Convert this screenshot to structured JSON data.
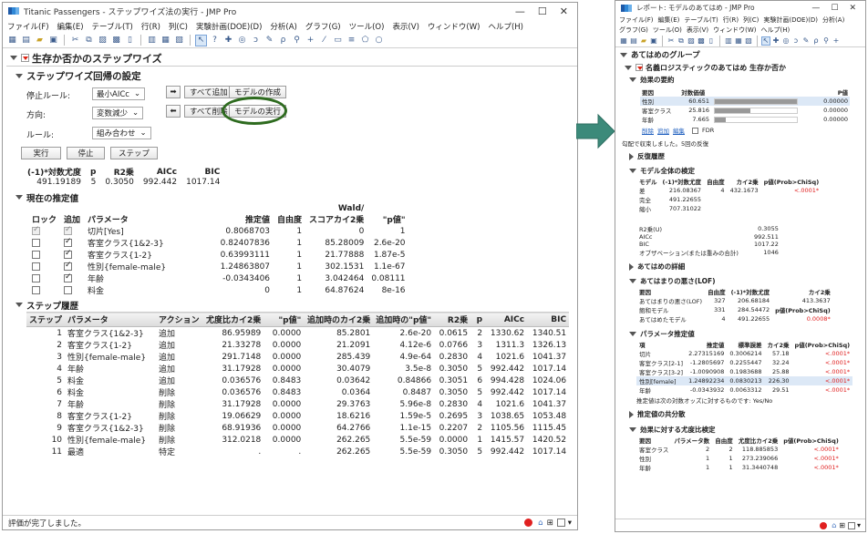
{
  "main": {
    "title": "Titanic Passengers - ステップワイズ法の実行 - JMP Pro",
    "menu": [
      "ファイル(F)",
      "編集(E)",
      "テーブル(T)",
      "行(R)",
      "列(C)",
      "実験計画(DOE)(D)",
      "分析(A)",
      "グラフ(G)",
      "ツール(O)",
      "表示(V)",
      "ウィンドウ(W)",
      "ヘルプ(H)"
    ],
    "report_title": "生存か否かのステップワイズ",
    "settings_title": "ステップワイズ回帰の設定",
    "stop_rule_label": "停止ルール:",
    "stop_rule_value": "最小AICc",
    "direction_label": "方向:",
    "direction_value": "変数減少",
    "rule_label": "ルール:",
    "rule_value": "組み合わせ",
    "btn_add_all": "すべて追加",
    "btn_make_model": "モデルの作成",
    "btn_remove_all": "すべて削除",
    "btn_run_model": "モデルの実行",
    "btn_go": "実行",
    "btn_stop": "停止",
    "btn_step": "ステップ",
    "summary_headers": [
      "(-1)*対数尤度",
      "p",
      "R2乗",
      "AICc",
      "BIC"
    ],
    "summary_values": [
      "491.19189",
      "5",
      "0.3050",
      "992.442",
      "1017.14"
    ],
    "current_est_title": "現在の推定値",
    "est_headers": [
      "ロック",
      "追加",
      "パラメータ",
      "推定値",
      "自由度",
      "スコアカイ2乗",
      "\"p値\""
    ],
    "est_wald": "Wald/",
    "est_rows": [
      {
        "lock": true,
        "lockdis": true,
        "add": true,
        "adddis": true,
        "param": "切片[Yes]",
        "est": "0.8068703",
        "df": "1",
        "chi": "0",
        "p": "1"
      },
      {
        "lock": false,
        "add": true,
        "param": "客室クラス{1&2-3}",
        "est": "0.82407836",
        "df": "1",
        "chi": "85.28009",
        "p": "2.6e-20"
      },
      {
        "lock": false,
        "add": true,
        "param": "客室クラス{1-2}",
        "est": "0.63993111",
        "df": "1",
        "chi": "21.77888",
        "p": "1.87e-5"
      },
      {
        "lock": false,
        "add": true,
        "param": "性別{female-male}",
        "est": "1.24863807",
        "df": "1",
        "chi": "302.1531",
        "p": "1.1e-67"
      },
      {
        "lock": false,
        "add": true,
        "param": "年齢",
        "est": "-0.0343406",
        "df": "1",
        "chi": "3.042464",
        "p": "0.08111"
      },
      {
        "lock": false,
        "add": false,
        "param": "料金",
        "est": "0",
        "df": "1",
        "chi": "64.87624",
        "p": "8e-16"
      }
    ],
    "history_title": "ステップ履歴",
    "hist_headers": [
      "ステップ",
      "パラメータ",
      "アクション",
      "尤度比カイ2乗",
      "\"p値\"",
      "追加時のカイ2乗",
      "追加時の\"p値\"",
      "R2乗",
      "p",
      "AICc",
      "BIC"
    ],
    "hist_rows": [
      [
        "1",
        "客室クラス{1&2-3}",
        "追加",
        "86.95989",
        "0.0000",
        "85.2801",
        "2.6e-20",
        "0.0615",
        "2",
        "1330.62",
        "1340.51"
      ],
      [
        "2",
        "客室クラス{1-2}",
        "追加",
        "21.33278",
        "0.0000",
        "21.2091",
        "4.12e-6",
        "0.0766",
        "3",
        "1311.3",
        "1326.13"
      ],
      [
        "3",
        "性別{female-male}",
        "追加",
        "291.7148",
        "0.0000",
        "285.439",
        "4.9e-64",
        "0.2830",
        "4",
        "1021.6",
        "1041.37"
      ],
      [
        "4",
        "年齢",
        "追加",
        "31.17928",
        "0.0000",
        "30.4079",
        "3.5e-8",
        "0.3050",
        "5",
        "992.442",
        "1017.14"
      ],
      [
        "5",
        "料金",
        "追加",
        "0.036576",
        "0.8483",
        "0.03642",
        "0.84866",
        "0.3051",
        "6",
        "994.428",
        "1024.06"
      ],
      [
        "6",
        "料金",
        "削除",
        "0.036576",
        "0.8483",
        "0.0364",
        "0.8487",
        "0.3050",
        "5",
        "992.442",
        "1017.14"
      ],
      [
        "7",
        "年齢",
        "削除",
        "31.17928",
        "0.0000",
        "29.3763",
        "5.96e-8",
        "0.2830",
        "4",
        "1021.6",
        "1041.37"
      ],
      [
        "8",
        "客室クラス{1-2}",
        "削除",
        "19.06629",
        "0.0000",
        "18.6216",
        "1.59e-5",
        "0.2695",
        "3",
        "1038.65",
        "1053.48"
      ],
      [
        "9",
        "客室クラス{1&2-3}",
        "削除",
        "68.91936",
        "0.0000",
        "64.2766",
        "1.1e-15",
        "0.2207",
        "2",
        "1105.56",
        "1115.45"
      ],
      [
        "10",
        "性別{female-male}",
        "削除",
        "312.0218",
        "0.0000",
        "262.265",
        "5.5e-59",
        "0.0000",
        "1",
        "1415.57",
        "1420.52"
      ],
      [
        "11",
        "最適",
        "特定",
        ".",
        ".",
        "262.265",
        "5.5e-59",
        "0.3050",
        "5",
        "992.442",
        "1017.14"
      ]
    ],
    "status": "評価が完了しました。"
  },
  "report": {
    "title": "レポート: モデルのあてはめ - JMP Pro",
    "menu1": [
      "ファイル(F)",
      "編集(E)",
      "テーブル(T)",
      "行(R)",
      "列(C)",
      "実験計画(DOE)(D)",
      "分析(A)"
    ],
    "menu2": [
      "グラフ(G)",
      "ツール(O)",
      "表示(V)",
      "ウィンドウ(W)",
      "ヘルプ(H)"
    ],
    "group_title": "あてはめのグループ",
    "logistic_title": "名義ロジスティックのあてはめ 生存か否か",
    "effect_summary_title": "効果の要約",
    "effect_headers": [
      "要因",
      "対数価値",
      "P値"
    ],
    "effect_rows": [
      {
        "name": "性別",
        "val": "60.651",
        "frac": 1.0,
        "p": "0.00000"
      },
      {
        "name": "客室クラス",
        "val": "25.816",
        "frac": 0.43,
        "p": "0.00000"
      },
      {
        "name": "年齢",
        "val": "7.665",
        "frac": 0.13,
        "p": "0.00000"
      }
    ],
    "effect_links": [
      "削除",
      "追加",
      "編集"
    ],
    "fdr_label": "FDR",
    "converge_note": "勾配で収束しました。5回の反復",
    "iter_title": "反復履歴",
    "whole_title": "モデル全体の検定",
    "whole_headers": [
      "モデル",
      "(-1)*対数尤度",
      "自由度",
      "カイ2乗",
      "p値(Prob>ChiSq)"
    ],
    "whole_rows": [
      [
        "差",
        "216.08367",
        "4",
        "432.1673",
        "<.0001*"
      ],
      [
        "完全",
        "491.22655",
        "",
        "",
        ""
      ],
      [
        "縮小",
        "707.31022",
        "",
        "",
        ""
      ]
    ],
    "stats_labels": [
      "R2乗(U)",
      "AICc",
      "BIC",
      "オブザベーション(または重みの合計)"
    ],
    "stats_values": [
      "0.3055",
      "992.511",
      "1017.22",
      "1046"
    ],
    "detail_title": "あてはめの詳細",
    "lof_title": "あてはまりの悪さ(LOF)",
    "lof_headers": [
      "要因",
      "自由度",
      "(-1)*対数尤度",
      "カイ2乗"
    ],
    "lof_rows": [
      [
        "あてはまりの悪さ(LOF)",
        "327",
        "206.68184",
        "413.3637"
      ],
      [
        "飽和モデル",
        "331",
        "284.54472",
        "p値(Prob>ChiSq)"
      ],
      [
        "あてはめたモデル",
        "4",
        "491.22655",
        "0.0008*"
      ]
    ],
    "param_title": "パラメータ推定値",
    "param_headers": [
      "項",
      "推定値",
      "標準誤差",
      "カイ2乗",
      "p値(Prob>ChiSq)"
    ],
    "param_rows": [
      [
        "切片",
        "2.27315169",
        "0.3006214",
        "57.18",
        "<.0001*"
      ],
      [
        "客室クラス[2-1]",
        "-1.2805697",
        "0.2255447",
        "32.24",
        "<.0001*"
      ],
      [
        "客室クラス[3-2]",
        "-1.0090908",
        "0.1983688",
        "25.88",
        "<.0001*"
      ],
      [
        "性別[female]",
        "1.24892234",
        "0.0830213",
        "226.30",
        "<.0001*"
      ],
      [
        "年齢",
        "-0.0343932",
        "0.0063312",
        "29.51",
        "<.0001*"
      ]
    ],
    "param_note": "推定値は次の対数オッズに対するものです: Yes/No",
    "cov_title": "推定値の共分散",
    "lr_title": "効果に対する尤度比検定",
    "lr_headers": [
      "要因",
      "パラメータ数",
      "自由度",
      "尤度比カイ2乗",
      "p値(Prob>ChiSq)"
    ],
    "lr_rows": [
      [
        "客室クラス",
        "2",
        "2",
        "118.885853",
        "<.0001*"
      ],
      [
        "性別",
        "1",
        "1",
        "273.239066",
        "<.0001*"
      ],
      [
        "年齢",
        "1",
        "1",
        "31.3440748",
        "<.0001*"
      ]
    ]
  },
  "colors": {
    "arrow": "#3c8a7a",
    "highlight": "#2e6b1f",
    "red": "#e02020"
  }
}
